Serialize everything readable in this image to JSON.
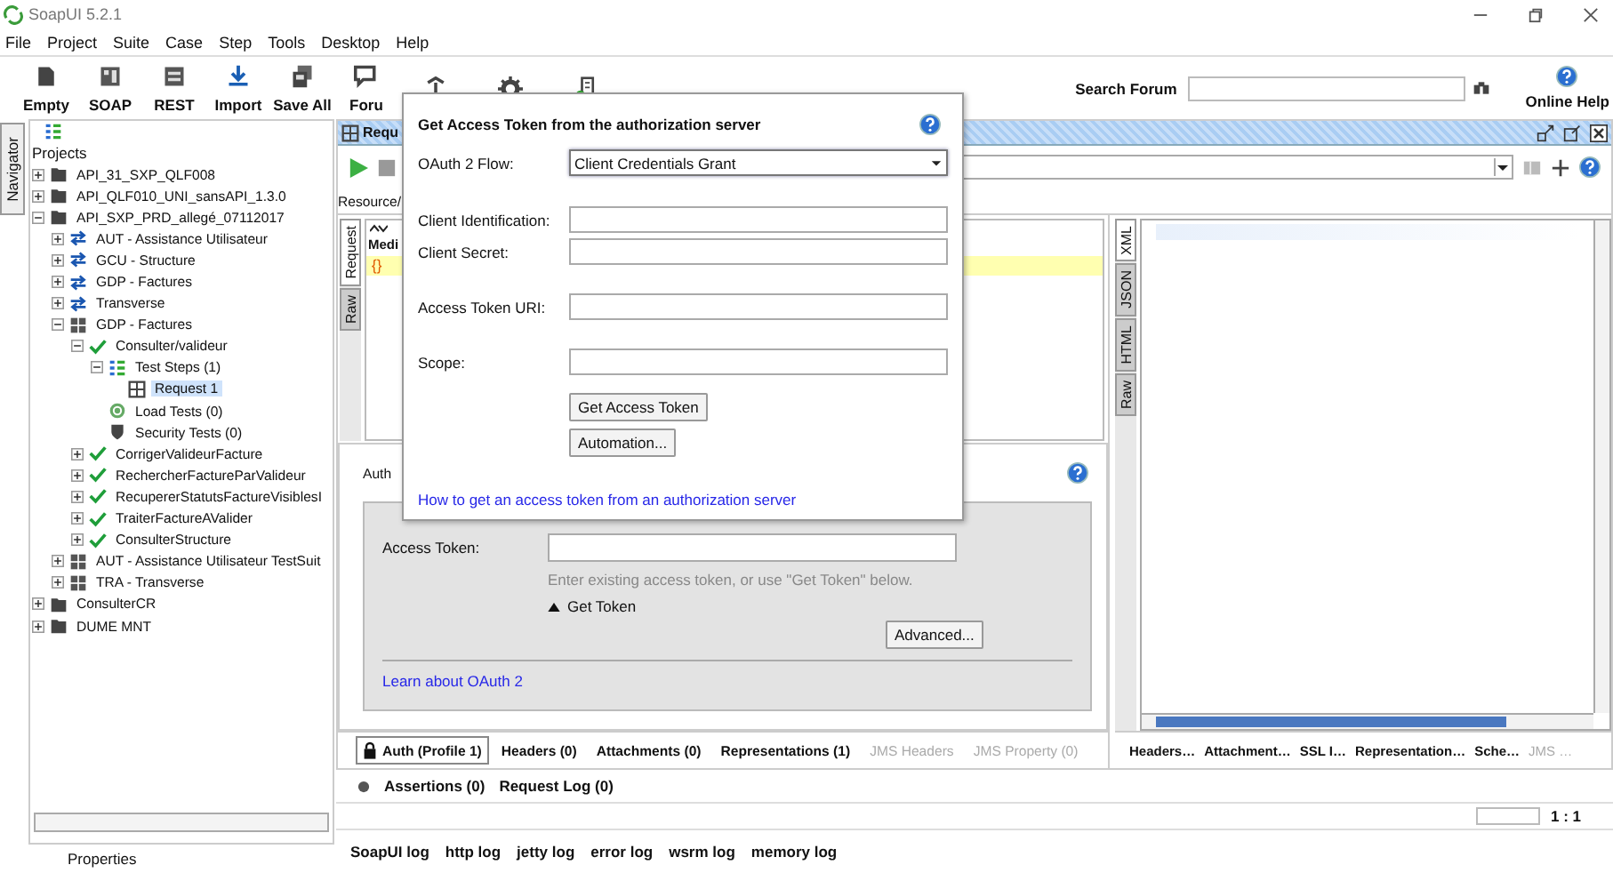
{
  "window": {
    "title": "SoapUI 5.2.1"
  },
  "menu": [
    "File",
    "Project",
    "Suite",
    "Case",
    "Step",
    "Tools",
    "Desktop",
    "Help"
  ],
  "toolbar": [
    {
      "label": "Empty",
      "kind": "empty"
    },
    {
      "label": "SOAP",
      "kind": "soap"
    },
    {
      "label": "REST",
      "kind": "rest"
    },
    {
      "label": "Import",
      "kind": "import"
    },
    {
      "label": "Save All",
      "kind": "save"
    },
    {
      "label": "Foru",
      "kind": "forum"
    },
    {
      "kind": "trial"
    },
    {
      "kind": "prefs"
    },
    {
      "kind": "proxy"
    }
  ],
  "search_forum": {
    "label": "Search Forum"
  },
  "online_help": "Online Help",
  "navigator": {
    "tab": "Navigator",
    "root": "Projects",
    "footer": "Properties",
    "tree": [
      {
        "label": "API_31_SXP_QLF008",
        "kind": "project",
        "expanded": false,
        "selected": false
      },
      {
        "label": "API_QLF010_UNI_sansAPI_1.3.0",
        "kind": "project",
        "expanded": false,
        "selected": false
      },
      {
        "label": "API_SXP_PRD_allegé_07112017",
        "kind": "project",
        "expanded": true,
        "selected": false,
        "children": [
          {
            "label": "AUT - Assistance Utilisateur",
            "kind": "service",
            "expanded": false,
            "selected": false
          },
          {
            "label": "GCU - Structure",
            "kind": "service",
            "expanded": false,
            "selected": false
          },
          {
            "label": "GDP - Factures",
            "kind": "service",
            "expanded": false,
            "selected": false
          },
          {
            "label": "Transverse",
            "kind": "service",
            "expanded": false,
            "selected": false
          },
          {
            "label": "GDP - Factures",
            "kind": "suite",
            "expanded": true,
            "selected": false,
            "children": [
              {
                "label": "Consulter/valideur",
                "kind": "case",
                "expanded": true,
                "selected": false,
                "children": [
                  {
                    "label": "Test Steps (1)",
                    "kind": "steps",
                    "expanded": true,
                    "selected": false,
                    "children": [
                      {
                        "label": "Request 1",
                        "kind": "request",
                        "selected": true
                      }
                    ]
                  },
                  {
                    "label": "Load Tests (0)",
                    "kind": "load",
                    "selected": false
                  },
                  {
                    "label": "Security Tests (0)",
                    "kind": "security",
                    "selected": false
                  }
                ]
              },
              {
                "label": "CorrigerValideurFacture",
                "kind": "case",
                "expanded": false,
                "selected": false
              },
              {
                "label": "RechercherFactureParValideur",
                "kind": "case",
                "expanded": false,
                "selected": false
              },
              {
                "label": "RecupererStatutsFactureVisiblesI",
                "kind": "case",
                "expanded": false,
                "selected": false
              },
              {
                "label": "TraiterFactureAValider",
                "kind": "case",
                "expanded": false,
                "selected": false
              },
              {
                "label": "ConsulterStructure",
                "kind": "case",
                "expanded": false,
                "selected": false
              }
            ]
          },
          {
            "label": "AUT - Assistance Utilisateur TestSuit",
            "kind": "suite",
            "expanded": false,
            "selected": false
          },
          {
            "label": "TRA - Transverse",
            "kind": "suite",
            "expanded": false,
            "selected": false
          }
        ]
      },
      {
        "label": "ConsulterCR",
        "kind": "project",
        "expanded": false,
        "selected": false
      },
      {
        "label": "DUME MNT",
        "kind": "project",
        "expanded": false,
        "selected": false
      }
    ]
  },
  "request": {
    "title": "Requ",
    "resource_label": "Resource/",
    "media_label": "Medi",
    "body": "{}",
    "request_tabs": [
      {
        "label": "Request",
        "selected": true
      },
      {
        "label": "Raw",
        "selected": false
      }
    ],
    "response_tabs": [
      {
        "label": "XML",
        "selected": true
      },
      {
        "label": "JSON",
        "selected": false
      },
      {
        "label": "HTML",
        "selected": false
      },
      {
        "label": "Raw",
        "selected": false
      }
    ],
    "auth": {
      "label": "Auth",
      "access_token_label": "Access Token:",
      "hint": "Enter existing access token, or use \"Get Token\" below.",
      "get_token": "Get Token",
      "advanced": "Advanced...",
      "learn": "Learn about OAuth 2"
    },
    "bottom_tabs": [
      {
        "label": "Auth (Profile 1)",
        "selected": true,
        "disabled": false
      },
      {
        "label": "Headers (0)",
        "selected": false,
        "disabled": false
      },
      {
        "label": "Attachments (0)",
        "selected": false,
        "disabled": false
      },
      {
        "label": "Representations (1)",
        "selected": false,
        "disabled": false
      },
      {
        "label": "JMS Headers",
        "selected": false,
        "disabled": true
      },
      {
        "label": "JMS Property (0)",
        "selected": false,
        "disabled": true
      }
    ],
    "response_bottom_tabs": [
      {
        "label": "Headers…",
        "disabled": false
      },
      {
        "label": "Attachment…",
        "disabled": false
      },
      {
        "label": "SSL I…",
        "disabled": false
      },
      {
        "label": "Representation…",
        "disabled": false
      },
      {
        "label": "Sche…",
        "disabled": false
      },
      {
        "label": "JMS …",
        "disabled": true
      }
    ],
    "assertions": "Assertions (0)",
    "request_log": "Request Log (0)",
    "position": "1 : 1"
  },
  "log_tabs": [
    "SoapUI log",
    "http log",
    "jetty log",
    "error log",
    "wsrm log",
    "memory log"
  ],
  "dialog": {
    "title": "Get Access Token from the authorization server",
    "flow_label": "OAuth 2 Flow:",
    "flow_value": "Client Credentials Grant",
    "fields": [
      {
        "label": "Client Identification:",
        "kind": "tight"
      },
      {
        "label": "Client Secret:",
        "kind": "tight"
      },
      {
        "label": "Access Token URI:",
        "kind": "spaced"
      },
      {
        "label": "Scope:",
        "kind": "spaced"
      }
    ],
    "buttons": [
      "Get Access Token",
      "Automation..."
    ],
    "link": "How to get an access token from an authorization server"
  }
}
